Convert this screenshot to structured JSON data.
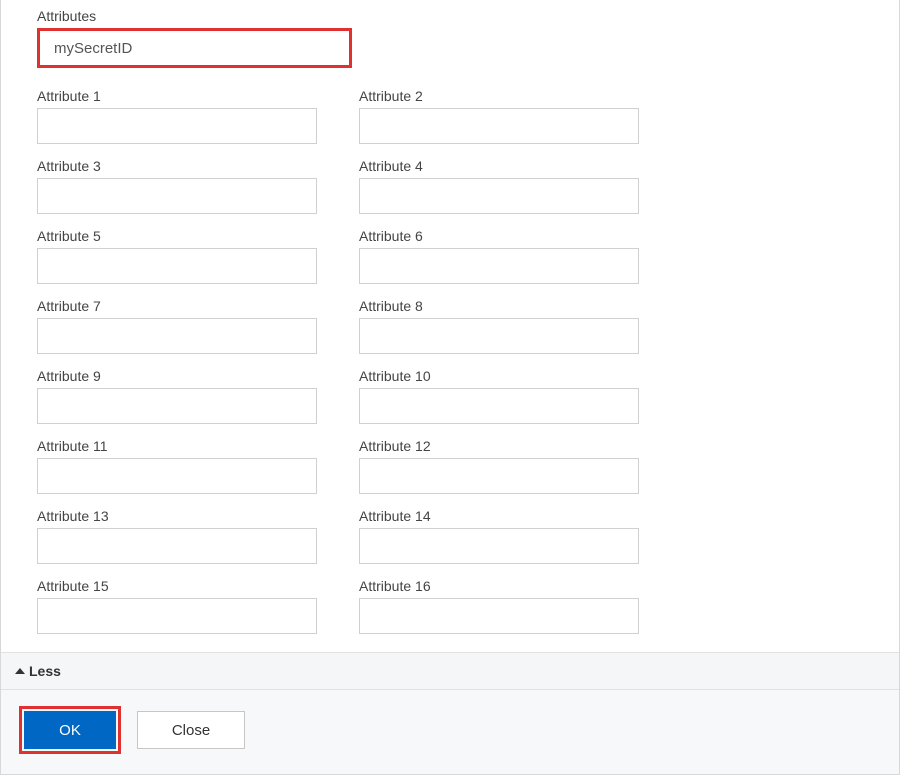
{
  "section": {
    "label": "Attributes",
    "highlighted_value": "mySecretID"
  },
  "attributes": [
    {
      "label": "Attribute 1",
      "value": ""
    },
    {
      "label": "Attribute 2",
      "value": ""
    },
    {
      "label": "Attribute 3",
      "value": ""
    },
    {
      "label": "Attribute 4",
      "value": ""
    },
    {
      "label": "Attribute 5",
      "value": ""
    },
    {
      "label": "Attribute 6",
      "value": ""
    },
    {
      "label": "Attribute 7",
      "value": ""
    },
    {
      "label": "Attribute 8",
      "value": ""
    },
    {
      "label": "Attribute 9",
      "value": ""
    },
    {
      "label": "Attribute 10",
      "value": ""
    },
    {
      "label": "Attribute 11",
      "value": ""
    },
    {
      "label": "Attribute 12",
      "value": ""
    },
    {
      "label": "Attribute 13",
      "value": ""
    },
    {
      "label": "Attribute 14",
      "value": ""
    },
    {
      "label": "Attribute 15",
      "value": ""
    },
    {
      "label": "Attribute 16",
      "value": ""
    }
  ],
  "toggle": {
    "less_label": "Less"
  },
  "footer": {
    "ok_label": "OK",
    "close_label": "Close"
  }
}
